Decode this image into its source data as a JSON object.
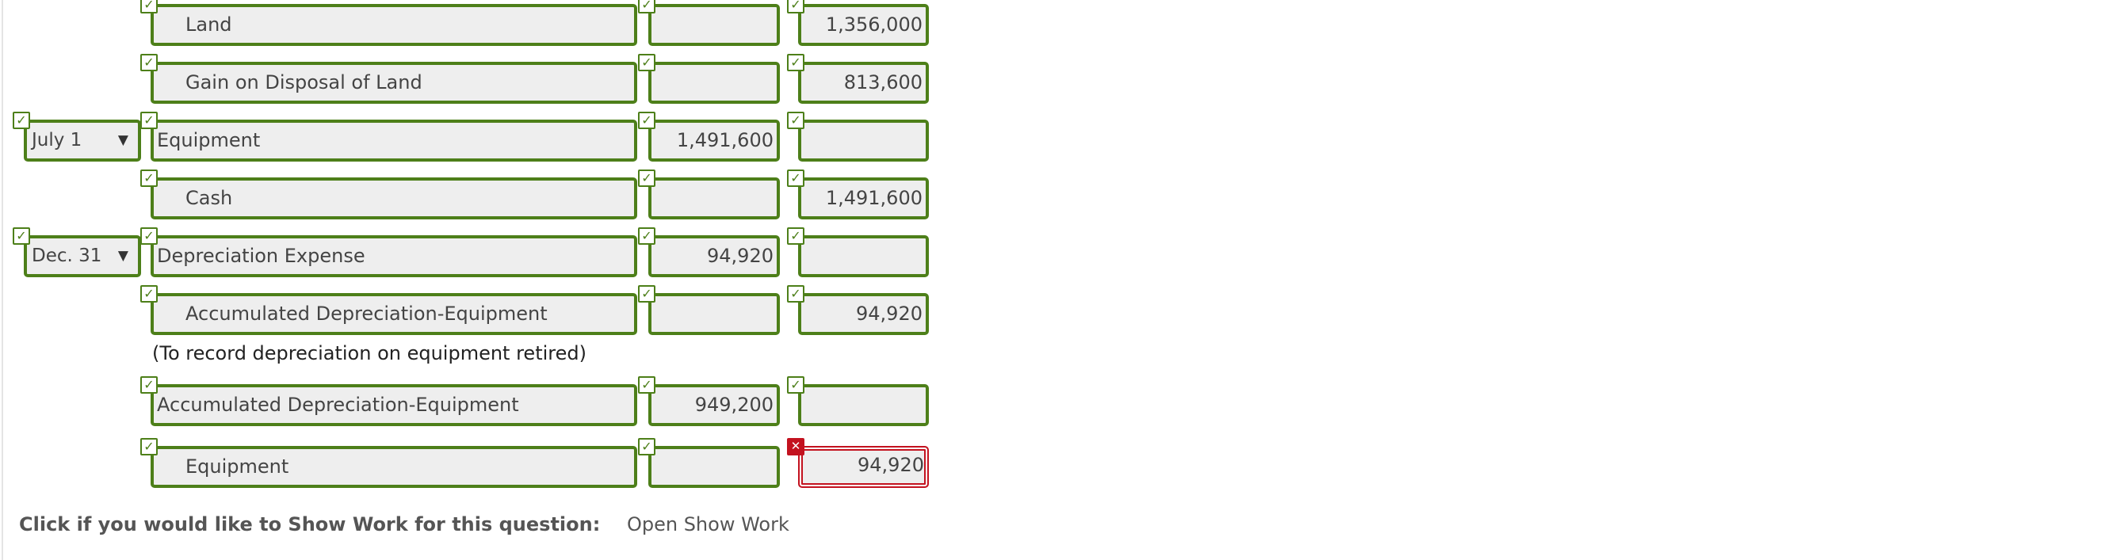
{
  "rows": [
    {
      "date": "",
      "account": "Land",
      "debit": "",
      "credit": "1,356,000"
    },
    {
      "date": "",
      "account": "Gain on Disposal of Land",
      "debit": "",
      "credit": "813,600"
    },
    {
      "date": "July 1",
      "account": "Equipment",
      "debit": "1,491,600",
      "credit": ""
    },
    {
      "date": "",
      "account": "Cash",
      "debit": "",
      "credit": "1,491,600"
    },
    {
      "date": "Dec. 31",
      "account": "Depreciation Expense",
      "debit": "94,920",
      "credit": ""
    },
    {
      "date": "",
      "account": "Accumulated Depreciation-Equipment",
      "debit": "",
      "credit": "94,920"
    },
    {
      "date": "",
      "account": "Accumulated Depreciation-Equipment",
      "debit": "949,200",
      "credit": ""
    },
    {
      "date": "",
      "account": "Equipment",
      "debit": "",
      "credit": "94,920"
    }
  ],
  "note": "(To record depreciation on equipment retired)",
  "icons": {
    "correct": "check-mark-icon",
    "incorrect": "cross-mark-icon",
    "dropdown": "triangle-down-icon"
  },
  "colors": {
    "correct": "#4d7f19",
    "incorrect": "#c3121f",
    "field_bg": "#eeeeee"
  },
  "footer": {
    "label": "Click if you would like to Show Work for this question:",
    "link": "Open Show Work"
  }
}
